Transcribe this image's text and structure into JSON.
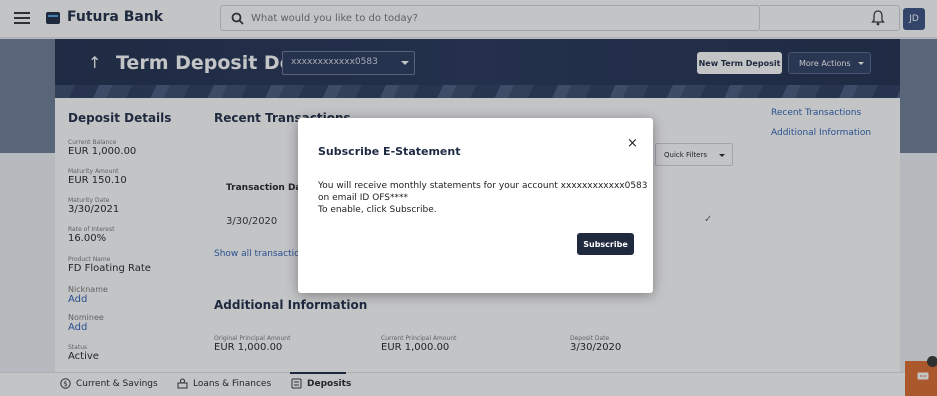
{
  "topbar": {
    "brand": "Futura Bank",
    "search_placeholder": "What would you like to do today?",
    "avatar_initials": "JD"
  },
  "header": {
    "title": "Term Deposit Details",
    "account_masked": "xxxxxxxxxxxx0583",
    "new_deposit_label": "New Term Deposit",
    "more_actions_label": "More Actions"
  },
  "deposit_details": {
    "title": "Deposit Details",
    "fields": [
      {
        "label": "Current Balance",
        "value": "EUR 1,000.00"
      },
      {
        "label": "Maturity Amount",
        "value": "EUR 150.10"
      },
      {
        "label": "Maturity Date",
        "value": "3/30/2021"
      },
      {
        "label": "Rate of Interest",
        "value": "16.00%"
      },
      {
        "label": "Product Name",
        "value": "FD Floating Rate"
      }
    ],
    "nickname_label": "Nickname",
    "nickname_action": "Add",
    "nominee_label": "Nominee",
    "nominee_action": "Add",
    "status_label": "Status",
    "status_value": "Active"
  },
  "recent_transactions": {
    "title": "Recent Transactions",
    "quick_filters_label": "Quick Filters",
    "column_transaction_date": "Transaction Date",
    "row_date": "3/30/2020",
    "row_check": "✓",
    "show_all_label": "Show all transactions"
  },
  "side_links": [
    "Recent Transactions",
    "Additional Information"
  ],
  "additional_info": {
    "title": "Additional Information",
    "fields": [
      {
        "label": "Original Principal Amount",
        "value": "EUR 1,000.00"
      },
      {
        "label": "Current Principal Amount",
        "value": "EUR 1,000.00"
      },
      {
        "label": "Deposit Date",
        "value": "3/30/2020"
      }
    ]
  },
  "bottom_nav": [
    {
      "label": "Current & Savings"
    },
    {
      "label": "Loans & Finances"
    },
    {
      "label": "Deposits"
    }
  ],
  "modal": {
    "title": "Subscribe E-Statement",
    "line1": "You will receive monthly statements for your account xxxxxxxxxxxx0583",
    "line2": "on email ID OFS****",
    "line3": "To enable, click Subscribe.",
    "subscribe_label": "Subscribe",
    "close_glyph": "×"
  },
  "colors": {
    "brand_navy": "#1d2a44",
    "link_blue": "#2b5fb4",
    "chat_orange": "#e06a2b"
  }
}
